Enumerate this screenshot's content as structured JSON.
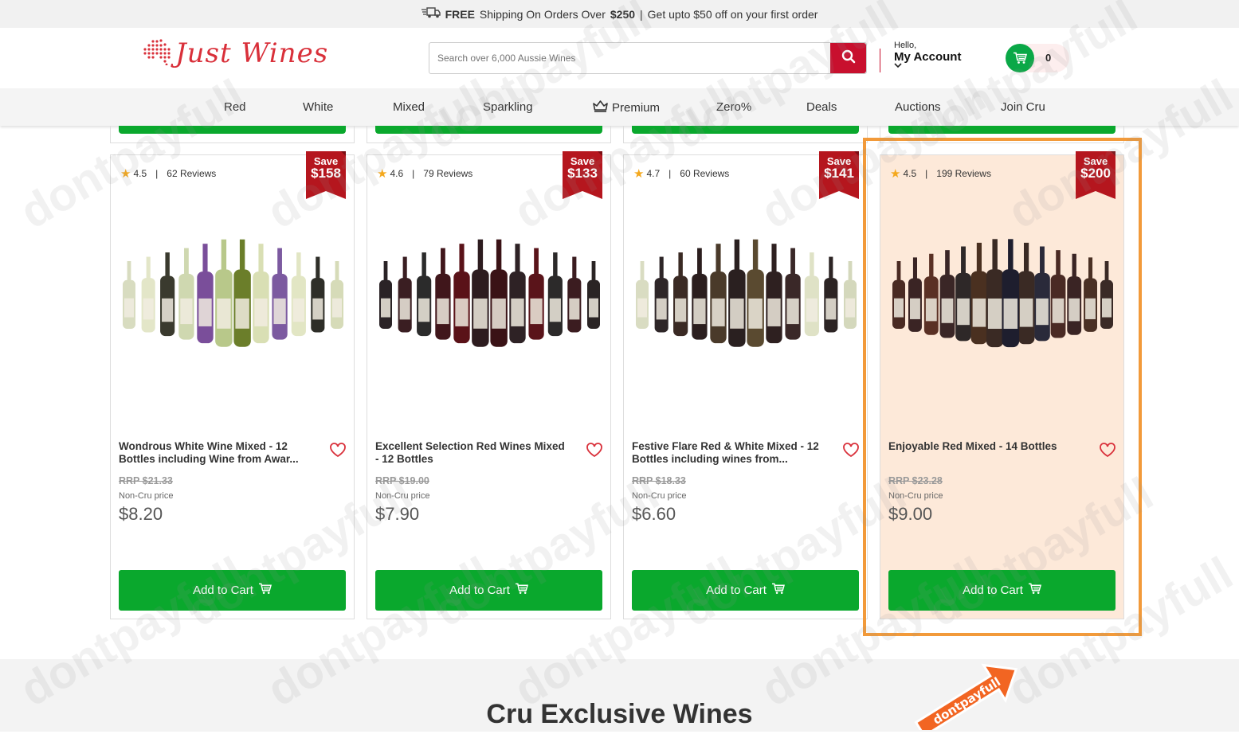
{
  "topbar": {
    "free_label": "FREE",
    "shipping_text": "Shipping On Orders Over",
    "threshold": "$250",
    "separator": "|",
    "offer": "Get upto $50 off on your first order"
  },
  "header": {
    "logo_text": "Just Wines",
    "search_placeholder": "Search over 6,000 Aussie Wines",
    "account_hello": "Hello,",
    "account_label": "My Account",
    "cart_count": "0"
  },
  "nav": {
    "items": [
      "Red",
      "White",
      "Mixed",
      "Sparkling",
      "Premium",
      "Zero%",
      "Deals",
      "Auctions",
      "Join Cru"
    ]
  },
  "products": [
    {
      "rating": "4.5",
      "reviews": "62 Reviews",
      "save_label": "Save",
      "save_amount": "$158",
      "name": "Wondrous White Wine Mixed - 12 Bottles including Wine from Awar...",
      "rrp": "RRP $21.33",
      "price_label": "Non-Cru price",
      "price": "$8.20",
      "cta": "Add to Cart",
      "bottle_count": 12,
      "bottle_colors": [
        "#d8dcc0",
        "#e3e6c8",
        "#3a3a2e",
        "#cfd8b0",
        "#7a4e9a",
        "#b8c88a",
        "#6b7e2a",
        "#d9dfb4",
        "#7c5aa0",
        "#e2e6c4",
        "#2e2e28",
        "#d6dbb8"
      ]
    },
    {
      "rating": "4.6",
      "reviews": "79 Reviews",
      "save_label": "Save",
      "save_amount": "$133",
      "name": "Excellent Selection Red Wines Mixed - 12 Bottles",
      "rrp": "RRP $19.00",
      "price_label": "Non-Cru price",
      "price": "$7.90",
      "cta": "Add to Cart",
      "bottle_count": 12,
      "bottle_colors": [
        "#2a2326",
        "#3a1e22",
        "#2b2b2b",
        "#40161b",
        "#5a1218",
        "#2d1c1f",
        "#3a1216",
        "#2e2225",
        "#5a141a",
        "#2c2a2a",
        "#3b1c20",
        "#2a2424"
      ]
    },
    {
      "rating": "4.7",
      "reviews": "60 Reviews",
      "save_label": "Save",
      "save_amount": "$141",
      "name": "Festive Flare Red & White Mixed - 12 Bottles including wines from...",
      "rrp": "RRP $18.33",
      "price_label": "Non-Cru price",
      "price": "$6.60",
      "cta": "Add to Cart",
      "bottle_count": 12,
      "bottle_colors": [
        "#d9dcc2",
        "#2e2628",
        "#3a2a24",
        "#2b1e1e",
        "#4a3a2a",
        "#2a2020",
        "#5a4a30",
        "#2e2020",
        "#3a2828",
        "#dfe2c6",
        "#2c2424",
        "#d4d8bc"
      ]
    },
    {
      "rating": "4.5",
      "reviews": "199 Reviews",
      "save_label": "Save",
      "save_amount": "$200",
      "name": "Enjoyable Red Mixed - 14 Bottles",
      "rrp": "RRP $23.28",
      "price_label": "Non-Cru price",
      "price": "$9.00",
      "cta": "Add to Cart",
      "bottle_count": 14,
      "bottle_colors": [
        "#4a2a22",
        "#3a2424",
        "#5a3024",
        "#3a2626",
        "#2e2828",
        "#4a3020",
        "#3a2a24",
        "#1e1e2e",
        "#3a2a24",
        "#2a2a3a",
        "#4a2a24",
        "#3a2424",
        "#4a3024",
        "#3a2a26"
      ]
    }
  ],
  "section": {
    "title": "Cru Exclusive Wines"
  },
  "watermark": {
    "text": "dontpayfull"
  },
  "colors": {
    "brand_red": "#c8102e",
    "cta_green": "#0aa82d",
    "highlight_orange": "#f29a3a",
    "highlight_fill": "#fde9d9"
  }
}
